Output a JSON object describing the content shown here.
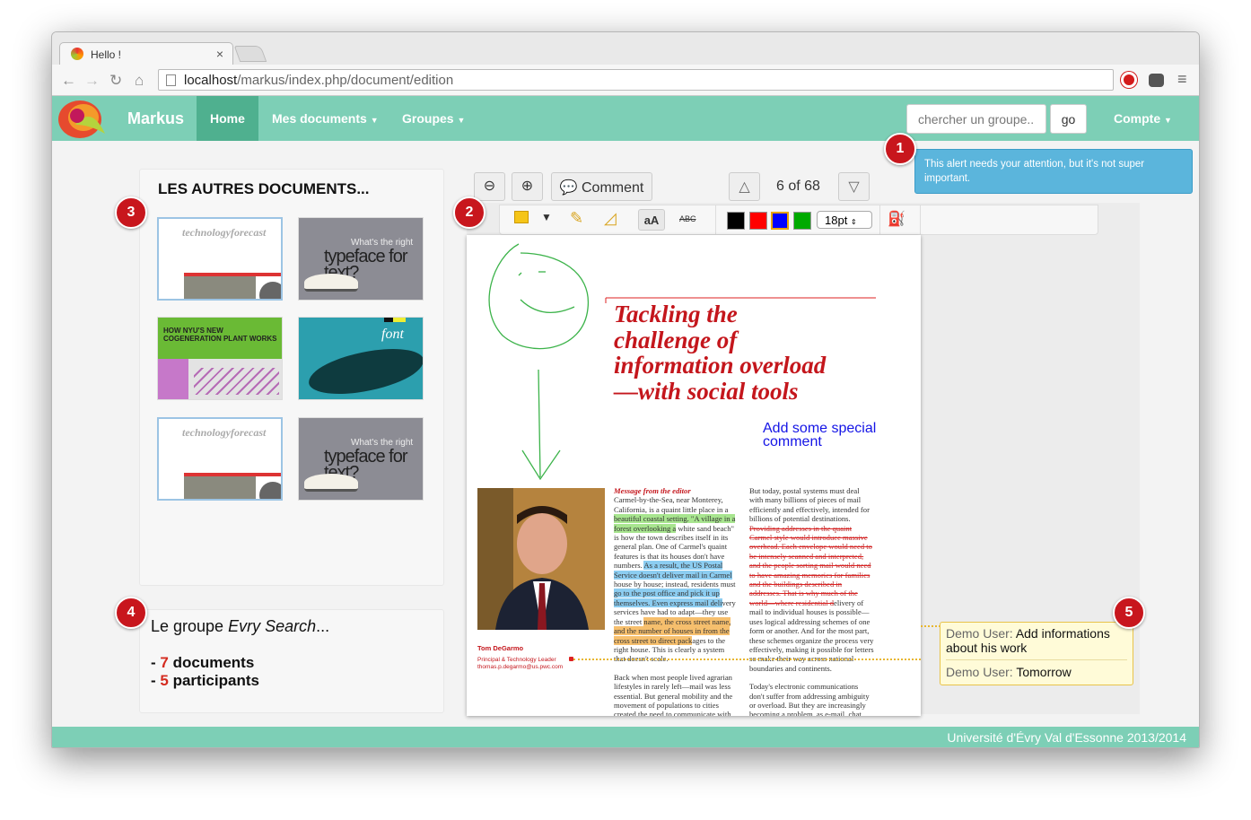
{
  "browser": {
    "tab_title": "Hello !",
    "tab_close": "×",
    "url_host": "localhost",
    "url_path": "/markus/index.php/document/edition"
  },
  "navbar": {
    "brand": "Markus",
    "items": [
      {
        "label": "Home"
      },
      {
        "label": "Mes documents"
      },
      {
        "label": "Groupes"
      }
    ],
    "search_placeholder": "chercher un groupe..",
    "go_label": "go",
    "account_label": "Compte"
  },
  "alert": {
    "text": "This alert needs your attention, but it's not super important."
  },
  "badges": [
    "1",
    "2",
    "3",
    "4",
    "5"
  ],
  "other_docs": {
    "title": "LES AUTRES DOCUMENTS...",
    "thumbs": [
      {
        "kind": "technologyforecast",
        "text": "technologyforecast"
      },
      {
        "kind": "typeface",
        "small": "What's the right",
        "big": "typeface for text?"
      },
      {
        "kind": "nyu",
        "text": "HOW NYU'S NEW COGENERATION PLANT WORKS"
      },
      {
        "kind": "font",
        "text": "font"
      },
      {
        "kind": "technologyforecast",
        "text": "technologyforecast"
      },
      {
        "kind": "typeface",
        "small": "What's the right",
        "big": "typeface for text?"
      }
    ]
  },
  "group": {
    "title_prefix": "Le groupe ",
    "title_name": "Evry Search",
    "title_suffix": "...",
    "doc_count": "7",
    "doc_label": "documents",
    "participant_count": "5",
    "participant_label": "participants"
  },
  "viewer": {
    "comment_label": "Comment",
    "page_indicator": "6 of 68",
    "font_size": "18pt",
    "font_btn": "aA",
    "strike_btn": "ABC",
    "colors": [
      "#000000",
      "#ff0000",
      "#0000ff",
      "#00aa00"
    ]
  },
  "document": {
    "headline": "Tackling the challenge of information overload—with social tools",
    "annotation": "Add some special comment",
    "byline_name": "Tom DeGarmo",
    "byline_title": "Principal & Technology Leader",
    "byline_email": "thomas.p.degarmo@us.pwc.com",
    "editor_label": "Message from the editor",
    "col1": [
      {
        "t": "Carmel-by-the-Sea, near Monterey, California, is a quaint little place in a ",
        "h": ""
      },
      {
        "t": "beautiful coastal setting. \"A village in a forest overlooking a",
        "h": "g"
      },
      {
        "t": " white sand beach\" is how the town describes itself in its general plan. One of Carmel's quaint features is that its houses don't have numbers. ",
        "h": ""
      },
      {
        "t": "As a result, the US Postal Service doesn't deliver mail in Carmel",
        "h": "b"
      },
      {
        "t": " house by house; instead, residents must ",
        "h": ""
      },
      {
        "t": "go to the post office and pick it up themselves. Even express mail deli",
        "h": "b"
      },
      {
        "t": "very services have had to adapt—they use the street ",
        "h": ""
      },
      {
        "t": "name, the cross street name, and the number of houses in from the cross street to direct pack",
        "h": "o"
      },
      {
        "t": "ages to the right house. This is clearly a system that doesn't scale.",
        "h": ""
      }
    ],
    "col1b": "Back when most people lived agrarian lifestyles in rarely left—mail was less essential. But general mobility and the movement of populations to cities created the need to communicate with people you weren't",
    "col2a": "But today, postal systems must deal with many billions of pieces of mail efficiently and effectively, intended for billions of potential destinations.",
    "col2_strike": "Providing addresses in the quaint Carmel style would introduce massive overhead. Each envelope would need to be intensely scanned and interpreted, and the people sorting mail would need to have amazing memories for families and the buildings described in addresses. That is why much of the world—where residential d",
    "col2b": "elivery of mail to individual houses is possible—uses logical addressing schemes of one form or another. And for the most part, these schemes organize the process very effectively, making it possible for letters so make their way across national boundaries and continents.",
    "col2c": "Today's electronic communications don't suffer from addressing ambiguity or overload. But they are increasingly becoming a problem, as e-mail, chat, voice mail, texting, and, yes, tweets"
  },
  "note": {
    "entries": [
      {
        "user": "Demo User:",
        "text": "Add informations about his work"
      },
      {
        "user": "Demo User:",
        "text": "Tomorrow"
      }
    ]
  },
  "footer": {
    "text": "Université d'Évry Val d'Essonne 2013/2014"
  }
}
